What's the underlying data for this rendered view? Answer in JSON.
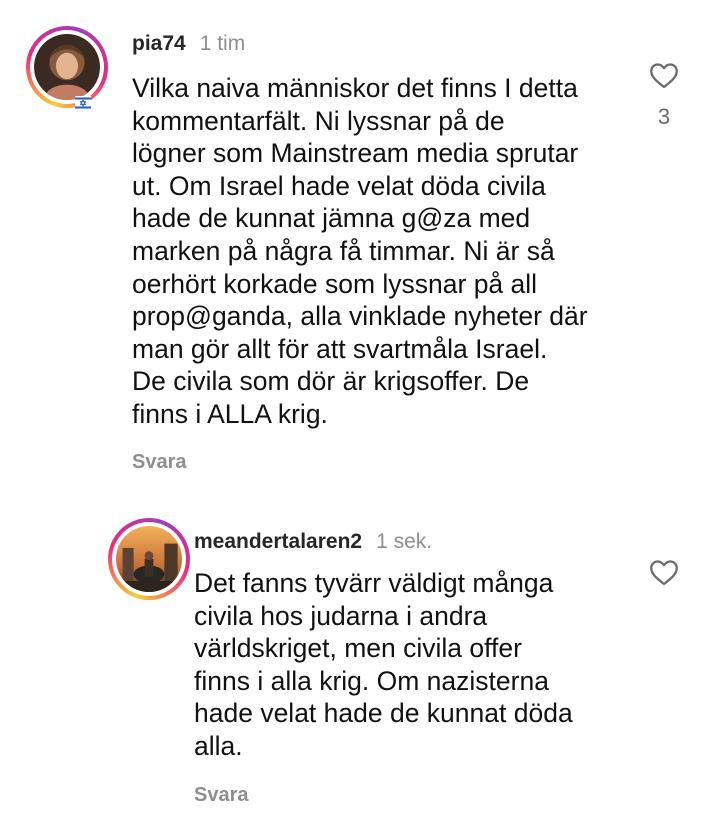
{
  "comments": [
    {
      "username": "pia74",
      "time": "1 tim",
      "text": "Vilka naiva människor det finns I detta\nkommentarfält. Ni lyssnar på de\nlögner som Mainstream media sprutar\nut. Om Israel hade velat döda civila\nhade de kunnat jämna g@za med\nmarken på några få timmar. Ni är så\noerhört korkade som lyssnar på all\nprop@ganda, alla vinklade nyheter där\nman gör allt för att svartmåla Israel.\nDe civila som dör är krigsoffer. De\nfinns i ALLA krig.",
      "reply_label": "Svara",
      "like_count": "3",
      "like_icon": "heart-outline-icon"
    },
    {
      "username": "meandertalaren2",
      "time": "1 sek.",
      "text": "Det fanns tyvärr väldigt många\ncivila hos judarna i andra\nvärldskriget, men civila offer\nfinns i alla krig. Om nazisterna\nhade velat hade de kunnat döda\nalla.",
      "reply_label": "Svara",
      "like_icon": "heart-outline-icon"
    }
  ],
  "colors": {
    "text": "#111111",
    "muted": "#8e8e8e",
    "story_ring": [
      "#f9ce34",
      "#ee2a7b",
      "#a13cc0"
    ]
  }
}
